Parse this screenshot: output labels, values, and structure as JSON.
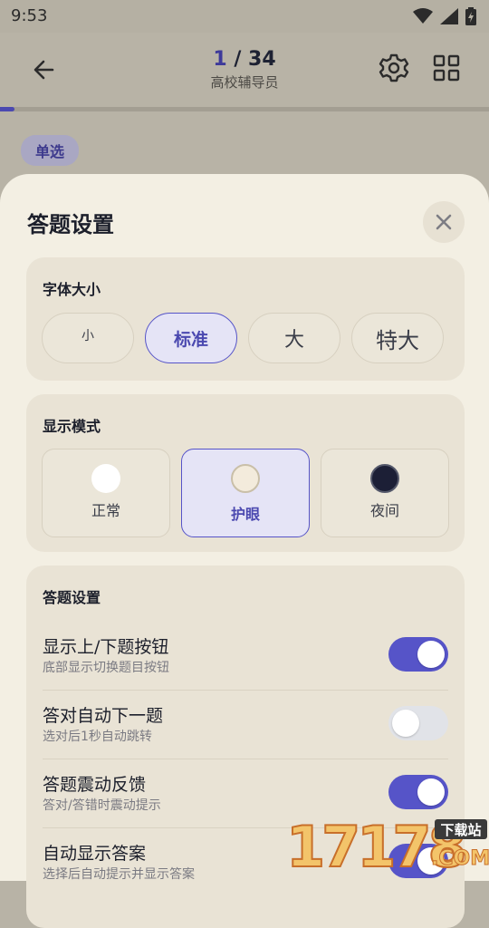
{
  "status_bar": {
    "time": "9:53"
  },
  "header": {
    "current": "1",
    "separator": " / ",
    "total": "34",
    "subject": "高校辅导员",
    "progress_fraction": 0.0294
  },
  "question_type": "单选",
  "sheet": {
    "title": "答题设置",
    "font_size": {
      "title": "字体大小",
      "options": [
        "小",
        "标准",
        "大",
        "特大"
      ],
      "selected": "标准"
    },
    "display_mode": {
      "title": "显示模式",
      "options": [
        {
          "label": "正常",
          "color": "#ffffff"
        },
        {
          "label": "护眼",
          "color": "#f3ebdc"
        },
        {
          "label": "夜间",
          "color": "#1c1f36"
        }
      ],
      "selected": "护眼"
    },
    "answer_settings": {
      "title": "答题设置",
      "items": [
        {
          "label": "显示上/下题按钮",
          "desc": "底部显示切换题目按钮",
          "on": true
        },
        {
          "label": "答对自动下一题",
          "desc": "选对后1秒自动跳转",
          "on": false
        },
        {
          "label": "答题震动反馈",
          "desc": "答对/答错时震动提示",
          "on": true
        },
        {
          "label": "自动显示答案",
          "desc": "选择后自动提示并显示答案",
          "on": true
        }
      ]
    }
  },
  "watermark": {
    "number": "17178",
    "badge": "下载站",
    "suffix": ".COM"
  },
  "colors": {
    "accent": "#5654c8",
    "sheet_bg": "#f3efe3",
    "card_bg": "#e9e3d5"
  }
}
